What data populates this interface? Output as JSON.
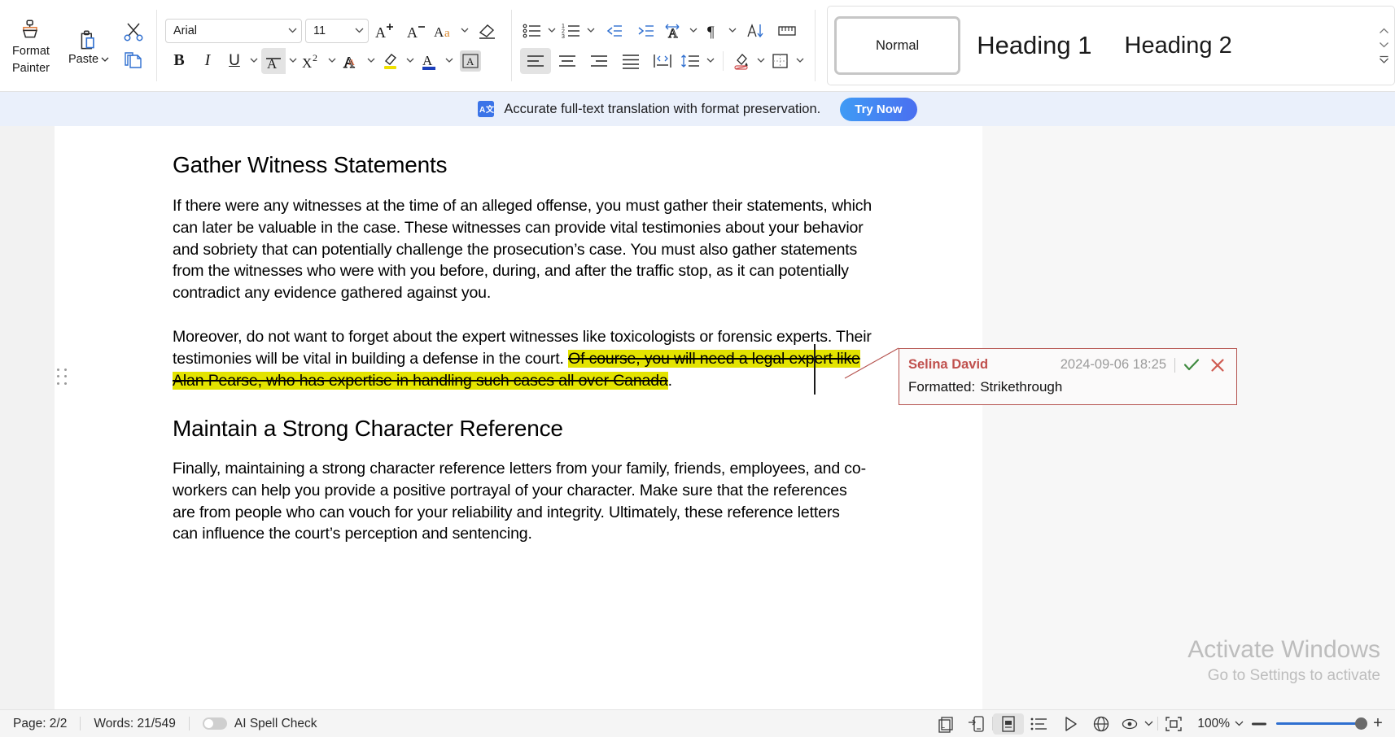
{
  "ribbon": {
    "format_painter_line1": "Format",
    "format_painter_line2": "Painter",
    "paste_label": "Paste",
    "font_name": "Arial",
    "font_size": "11",
    "icons_row1": [
      "format-painter-icon",
      "paste-icon",
      "cut-icon",
      "grow-font-icon",
      "shrink-font-icon",
      "change-case-icon",
      "clear-formatting-icon",
      "bullets-icon",
      "numbering-icon",
      "decrease-indent-icon",
      "increase-indent-icon",
      "text-direction-icon",
      "paragraph-marks-icon",
      "sort-icon",
      "ruler-icon"
    ],
    "icons_row2": [
      "bold-icon",
      "italic-icon",
      "underline-icon",
      "strikethrough-icon",
      "superscript-icon",
      "text-effects-icon",
      "highlight-color-icon",
      "font-color-icon",
      "text-box-icon",
      "align-left-icon",
      "align-center-icon",
      "align-right-icon",
      "justify-icon",
      "distribute-icon",
      "line-spacing-icon",
      "shading-icon",
      "borders-icon"
    ]
  },
  "styles": {
    "normal": "Normal",
    "heading1": "Heading 1",
    "heading2": "Heading 2"
  },
  "banner": {
    "icon": "translate-icon",
    "icon_text": "A",
    "message": "Accurate full-text translation with format preservation.",
    "cta": "Try Now"
  },
  "document": {
    "heading1": "Gather Witness Statements",
    "paragraph1": "If there were any witnesses at the time of an alleged offense, you must gather their statements, which can later be valuable in the case. These witnesses can provide vital testimonies about your behavior and sobriety that can potentially challenge the prosecution’s case. You must also gather statements from the witnesses who were with you before, during, and after the traffic stop, as it can potentially contradict any evidence gathered against you.",
    "paragraph2_plain": "Moreover, do not want to forget about the expert witnesses like toxicologists or forensic experts. Their testimonies will be vital in building a defense in the court. ",
    "paragraph2_tracked": "Of course, you will need a legal expert like Alan Pearse, who has expertise in handling such cases all over Canada",
    "paragraph2_tail": ".",
    "heading2": "Maintain a Strong Character Reference",
    "paragraph3": "Finally, maintaining a strong character reference letters from your family, friends, employees, and co-workers can help you provide a positive portrayal of your character.  Make sure that the references are from people who can vouch for your reliability and integrity. Ultimately, these reference letters can influence the court’s perception and sentencing.",
    "highlight_color": "#e3e300"
  },
  "comment": {
    "author": "Selina David",
    "timestamp": "2024-09-06 18:25",
    "body_label": "Formatted:",
    "body_value": "Strikethrough",
    "accept_icon": "accept-check-icon",
    "reject_icon": "reject-x-icon",
    "author_color": "#c0504d",
    "border_color": "#b5534f"
  },
  "watermark": {
    "line1": "Activate Windows",
    "line2": "Go to Settings to activate"
  },
  "statusbar": {
    "page": "Page: 2/2",
    "words": "Words: 21/549",
    "spell_check": "AI Spell Check",
    "view_icons": [
      "web-layout-icon",
      "mobile-view-icon",
      "print-layout-icon",
      "outline-icon",
      "read-mode-icon",
      "web-icon",
      "display-options-icon"
    ],
    "fit_icon": "fit-page-icon",
    "zoom": "100%"
  }
}
